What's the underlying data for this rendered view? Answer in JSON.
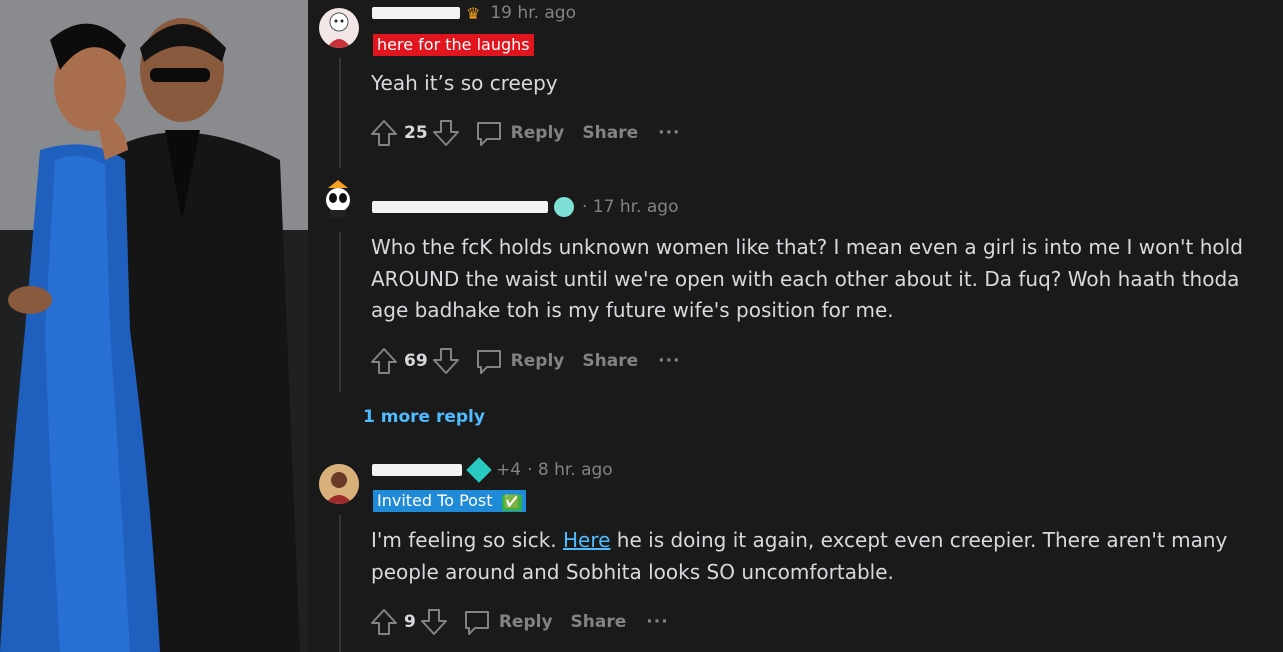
{
  "comments": [
    {
      "time": "19 hr. ago",
      "flair": "here for the laughs",
      "body": "Yeah it’s so creepy",
      "votes": "25",
      "reply_label": "Reply",
      "share_label": "Share",
      "more_label": "···"
    },
    {
      "time": "· 17 hr. ago",
      "body": "Who the fcK holds unknown women like that? I mean even a girl is into me I won't hold AROUND the waist until we're open with each other about it. Da fuq? Woh haath thoda age badhake toh is my future wife's position for me.",
      "votes": "69",
      "reply_label": "Reply",
      "share_label": "Share",
      "more_label": "···"
    },
    {
      "karma": "+4",
      "time": "· 8 hr. ago",
      "flair": "Invited To Post",
      "flair_emoji": "✅",
      "body_pre": "I'm feeling so sick. ",
      "body_link": "Here",
      "body_post": " he is doing it again, except even creepier. There aren't many people around and Sobhita looks SO uncomfortable.",
      "votes": "9",
      "reply_label": "Reply",
      "share_label": "Share",
      "more_label": "···"
    }
  ],
  "more_replies": "1 more reply",
  "colors": {
    "background": "#1a1a1b",
    "text": "#d7dadc",
    "muted": "#818384",
    "link": "#4fbcff",
    "flair_red": "#e0151d",
    "flair_blue": "#1f8ad8"
  },
  "icons": [
    "upvote-icon",
    "downvote-icon",
    "comment-icon",
    "overflow-icon",
    "crown-icon",
    "gem-icon"
  ]
}
